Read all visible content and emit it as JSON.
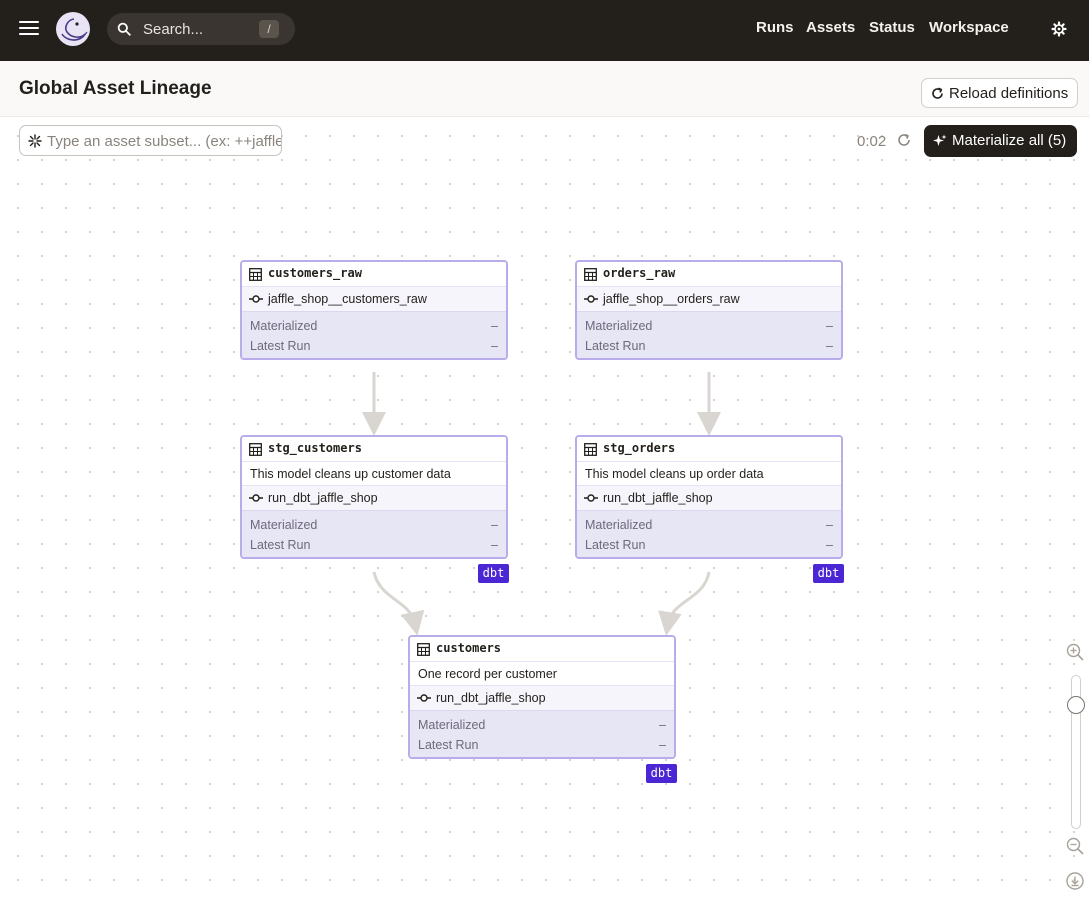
{
  "nav": {
    "search_placeholder": "Search...",
    "search_shortcut": "/",
    "links": [
      "Runs",
      "Assets",
      "Status",
      "Workspace"
    ]
  },
  "header": {
    "title": "Global Asset Lineage",
    "reload_label": "Reload definitions"
  },
  "toolbar": {
    "subset_placeholder": "Type an asset subset... (ex: ++jaffle",
    "timer": "0:02",
    "materialize_label": "Materialize all (5)"
  },
  "status_labels": {
    "materialized": "Materialized",
    "latest_run": "Latest Run",
    "empty_value": "–"
  },
  "nodes": [
    {
      "name": "customers_raw",
      "description": "",
      "op": "jaffle_shop__customers_raw",
      "tag": ""
    },
    {
      "name": "orders_raw",
      "description": "",
      "op": "jaffle_shop__orders_raw",
      "tag": ""
    },
    {
      "name": "stg_customers",
      "description": "This model cleans up customer data",
      "op": "run_dbt_jaffle_shop",
      "tag": "dbt"
    },
    {
      "name": "stg_orders",
      "description": "This model cleans up order data",
      "op": "run_dbt_jaffle_shop",
      "tag": "dbt"
    },
    {
      "name": "customers",
      "description": "One record per customer",
      "op": "run_dbt_jaffle_shop",
      "tag": "dbt"
    }
  ],
  "colors": {
    "topbar": "#231f1b",
    "node_border": "#b9acea",
    "dbt_tag": "#4b26d5",
    "edge": "#d9d6d1"
  },
  "icons": [
    "menu-icon",
    "dagster-logo-icon",
    "search-icon",
    "gear-icon",
    "refresh-icon",
    "sparkle-icon",
    "table-icon",
    "op-icon",
    "zoom-in-icon",
    "zoom-out-icon",
    "download-icon"
  ]
}
